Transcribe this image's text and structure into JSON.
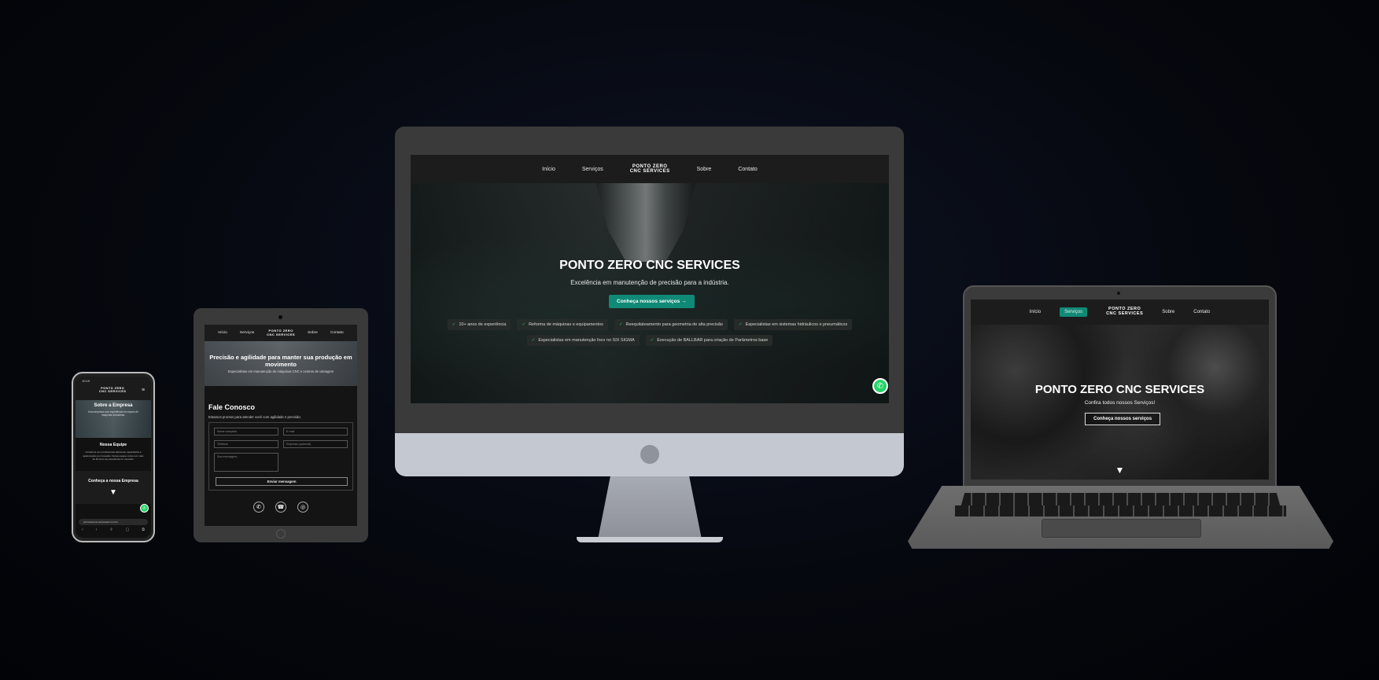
{
  "site": {
    "logo_line1": "PONTO ZERO",
    "logo_line2": "CNC SERVICES",
    "nav": {
      "home": "Início",
      "services": "Serviços",
      "about": "Sobre",
      "contact": "Contato"
    }
  },
  "desktop": {
    "title": "PONTO ZERO CNC SERVICES",
    "subtitle": "Excelência em manutenção de precisão para a indústria.",
    "cta": "Conheça nossos serviços →",
    "features_row1": [
      "10+ anos de experiência",
      "Reforma de máquinas e equipamentos",
      "Reequilateamento para geometria de alta precisão",
      "Especialistas em sistemas hidráulicos e pneumáticos"
    ],
    "features_row2": [
      "Especialistas em manutenção foco no SIX SIGMA",
      "Execução de BALLBAR para criação de Parâmetros base"
    ],
    "check_icon": "✓",
    "whatsapp_icon": "✆"
  },
  "laptop": {
    "title": "PONTO ZERO CNC SERVICES",
    "subtitle": "Confira todos nossos Serviços!",
    "cta": "Conheça nossos serviços",
    "arrow": "▼"
  },
  "tablet": {
    "hero_title": "Precisão e agilidade para manter sua produção em movimento",
    "hero_subtitle": "Especialistas em manutenção de máquinas CNC e centros de usinagem",
    "contact_title": "Fale Conosco",
    "contact_lead": "Estamos prontos para atender você com agilidade e precisão.",
    "fields": {
      "name": "Nome completo",
      "email": "E-mail",
      "phone": "Telefone",
      "company": "Empresa (opcional)",
      "message": "Sua mensagem..."
    },
    "send": "Enviar mensagem",
    "social_icons": [
      "✆",
      "☎",
      "◎"
    ]
  },
  "phone": {
    "status_time": "10:19",
    "hero_title": "Sobre a Empresa",
    "hero_subtitle": "Uma empresa com experiência em reparo de máquinas industriais.",
    "team_title": "Nossa Equipe",
    "team_text": "Contamos com profissionais altamente capacitados e apaixonados por inovação. Nossa equipe conta com mais de 20 anos de experiência no mercado.",
    "section_title": "Conheça a nossa Empresa",
    "arrow": "▼",
    "menu_icon": "≡",
    "url": "pontozerocnc-servicesinc.com.br",
    "toolbar": [
      "‹",
      "›",
      "⇪",
      "▢",
      "⧉"
    ]
  },
  "colors": {
    "accent": "#0f8a76",
    "whatsapp": "#25d366",
    "background": "#06080f"
  }
}
